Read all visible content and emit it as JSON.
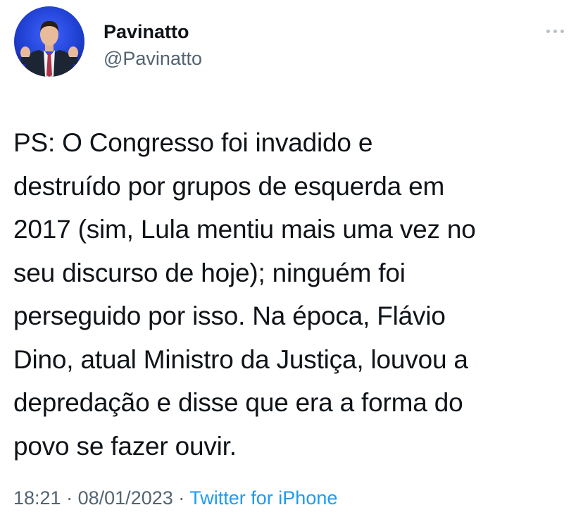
{
  "author": {
    "display_name": "Pavinatto",
    "handle": "@Pavinatto",
    "avatar_icon": "profile-photo-man-in-suit"
  },
  "tweet": {
    "lines": [
      "PS: O Congresso foi invadido e",
      "destruído por grupos de esquerda em",
      "2017 (sim, Lula mentiu mais uma vez no",
      "seu discurso de hoje); ninguém foi",
      "perseguido por isso. Na época, Flávio",
      "Dino, atual Ministro da Justiça, louvou a",
      "depredação e disse que era a forma do",
      "povo se fazer ouvir."
    ]
  },
  "meta": {
    "time": "18:21",
    "separator": "·",
    "date": "08/01/2023",
    "source": "Twitter for iPhone"
  },
  "more_icon": "more-horizontal-icon",
  "colors": {
    "text": "#0f1419",
    "secondary": "#536471",
    "link": "#1d9bf0"
  }
}
